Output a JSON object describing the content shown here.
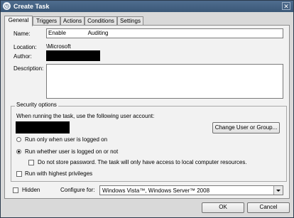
{
  "window": {
    "title": "Create Task",
    "close_glyph": "✕",
    "app_icon": "task-icon"
  },
  "tabs": [
    {
      "label": "General",
      "active": true
    },
    {
      "label": "Triggers"
    },
    {
      "label": "Actions"
    },
    {
      "label": "Conditions"
    },
    {
      "label": "Settings"
    }
  ],
  "general": {
    "name_label": "Name:",
    "name_value": "Enable              Auditing",
    "location_label": "Location:",
    "location_value": "\\Microsoft",
    "author_label": "Author:",
    "description_label": "Description:",
    "description_value": ""
  },
  "security": {
    "legend": "Security options",
    "user_account_text": "When running the task, use the following user account:",
    "change_user_button": "Change User or Group...",
    "radio_logged_on": "Run only when user is logged on",
    "radio_whether": "Run whether user is logged on or not",
    "radio_selected": "whether",
    "no_store_password": "Do not store password.  The task will only have access to local computer resources.",
    "highest_privileges": "Run with highest privileges"
  },
  "bottom": {
    "hidden_label": "Hidden",
    "configure_label": "Configure for:",
    "configure_value": "Windows Vista™, Windows Server™ 2008",
    "ok_button": "OK",
    "cancel_button": "Cancel"
  },
  "colors": {
    "titlebar": "#3b5877",
    "dialog": "#d9d9d9",
    "panel": "#f2f2f2",
    "redaction": "#000000"
  }
}
